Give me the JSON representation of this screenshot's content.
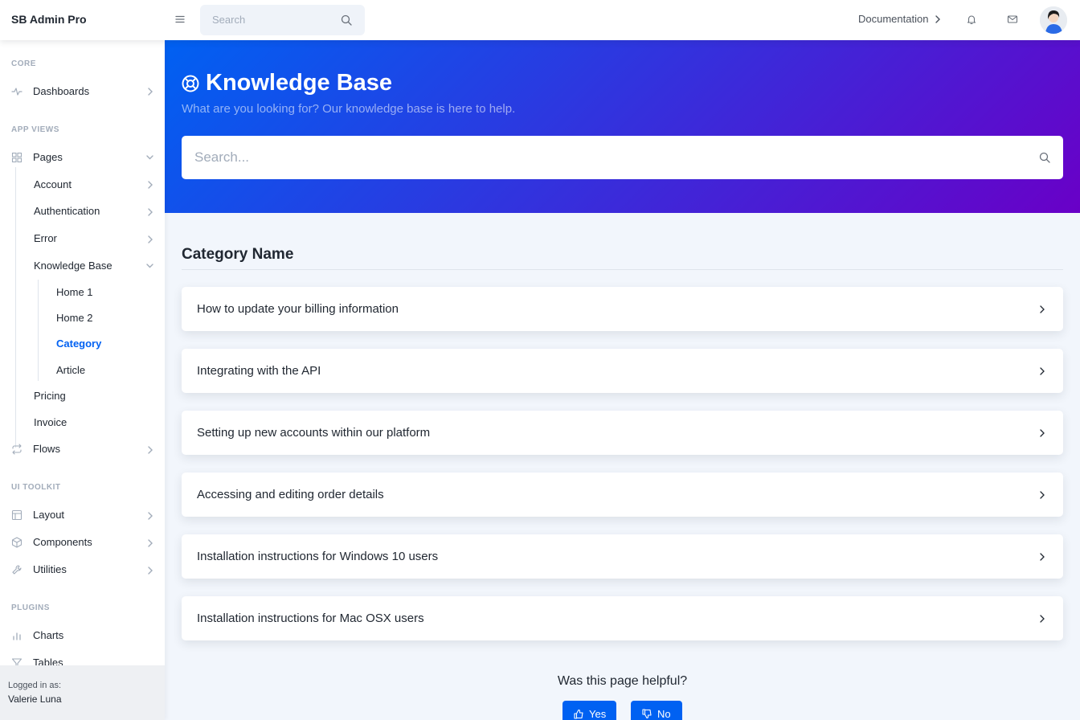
{
  "topbar": {
    "brand": "SB Admin Pro",
    "search_placeholder": "Search",
    "documentation_label": "Documentation"
  },
  "sidebar": {
    "sections": {
      "core": "Core",
      "app_views": "App Views",
      "ui_toolkit": "UI Toolkit",
      "plugins": "Plugins"
    },
    "items": {
      "dashboards": "Dashboards",
      "pages": "Pages",
      "account": "Account",
      "authentication": "Authentication",
      "error": "Error",
      "knowledge_base": "Knowledge Base",
      "home1": "Home 1",
      "home2": "Home 2",
      "category": "Category",
      "article": "Article",
      "pricing": "Pricing",
      "invoice": "Invoice",
      "flows": "Flows",
      "layout": "Layout",
      "components": "Components",
      "utilities": "Utilities",
      "charts": "Charts",
      "tables": "Tables"
    },
    "footer": {
      "subtitle": "Logged in as:",
      "name": "Valerie Luna"
    }
  },
  "header": {
    "title": "Knowledge Base",
    "subtitle": "What are you looking for? Our knowledge base is here to help.",
    "search_placeholder": "Search..."
  },
  "main": {
    "category_title": "Category Name",
    "articles": [
      "How to update your billing information",
      "Integrating with the API",
      "Setting up new accounts within our platform",
      "Accessing and editing order details",
      "Installation instructions for Windows 10 users",
      "Installation instructions for Mac OSX users"
    ],
    "helpful_question": "Was this page helpful?",
    "yes_label": "Yes",
    "no_label": "No"
  },
  "colors": {
    "primary": "#0061f2",
    "gradient_end": "#6900c7"
  }
}
